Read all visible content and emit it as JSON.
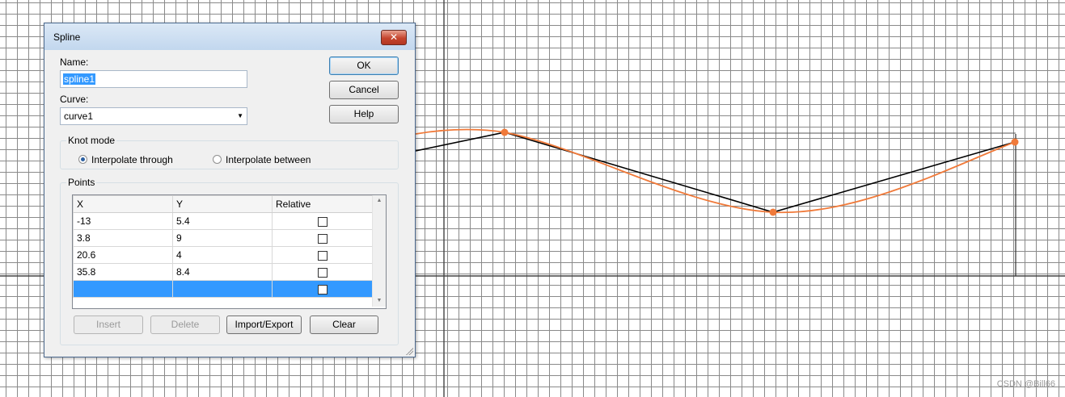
{
  "dialog": {
    "title": "Spline",
    "close_glyph": "✕",
    "name_label": "Name:",
    "name_value": "spline1",
    "curve_label": "Curve:",
    "curve_value": "curve1",
    "buttons": {
      "ok": "OK",
      "cancel": "Cancel",
      "help": "Help"
    },
    "knot_mode": {
      "label": "Knot mode",
      "options": [
        "Interpolate through",
        "Interpolate between"
      ],
      "selected": "Interpolate through"
    },
    "points": {
      "label": "Points",
      "columns": [
        "X",
        "Y",
        "Relative"
      ],
      "rows": [
        {
          "x": "-13",
          "y": "5.4",
          "relative": false
        },
        {
          "x": "3.8",
          "y": "9",
          "relative": false
        },
        {
          "x": "20.6",
          "y": "4",
          "relative": false
        },
        {
          "x": "35.8",
          "y": "8.4",
          "relative": false
        },
        {
          "x": "",
          "y": "",
          "relative": false,
          "selected": true
        }
      ]
    },
    "bottom_buttons": {
      "insert": "Insert",
      "delete": "Delete",
      "import_export": "Import/Export",
      "clear": "Clear"
    }
  },
  "workspace": {
    "control_polyline_color": "#000000",
    "spline_color": "#f07a3a",
    "grid_color": "#8a8a8a"
  },
  "watermark": "CSDN @Bill66"
}
